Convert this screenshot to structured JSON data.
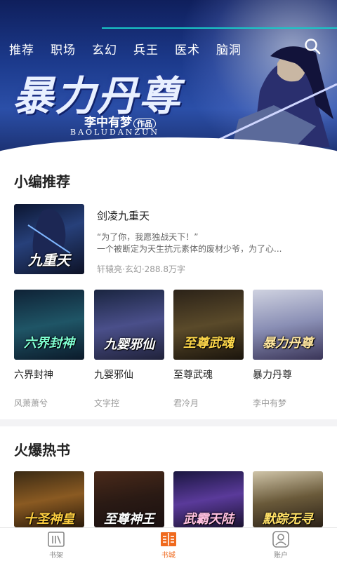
{
  "banner": {
    "tabs": [
      "推荐",
      "职场",
      "玄幻",
      "兵王",
      "医术",
      "脑洞"
    ],
    "title": "暴力丹尊",
    "author": "李中有梦",
    "author_tag": "作品",
    "pinyin": "BAOLUDANZUN",
    "slide_count": 3,
    "active_slide": 0
  },
  "recommend": {
    "title": "小编推荐",
    "featured": {
      "name": "剑凌九重天",
      "desc_line1": "“为了你，我愿独战天下！”",
      "desc_line2": "一个被断定为天生抗元素体的废材少爷，为了心...",
      "meta": "轩辕亮·玄幻·288.8万字",
      "cover_text": "九重天"
    },
    "books": [
      {
        "name": "六界封神",
        "author": "风萧萧兮",
        "cover_text": "六界封神"
      },
      {
        "name": "九婴邪仙",
        "author": "文字控",
        "cover_text": "九婴邪仙"
      },
      {
        "name": "至尊武魂",
        "author": "君冷月",
        "cover_text": "至尊武魂"
      },
      {
        "name": "暴力丹尊",
        "author": "李中有梦",
        "cover_text": "暴力丹尊"
      }
    ]
  },
  "hot": {
    "title": "火爆热书",
    "books": [
      {
        "cover_text": "十圣神皇"
      },
      {
        "cover_text": "至尊神王"
      },
      {
        "cover_text": "武霸天陆"
      },
      {
        "cover_text": "默踪无寻"
      }
    ]
  },
  "nav": {
    "items": [
      {
        "label": "书架",
        "icon": "bookshelf-icon"
      },
      {
        "label": "书城",
        "icon": "bookstore-icon"
      },
      {
        "label": "账户",
        "icon": "account-icon"
      }
    ],
    "active_color": "#f06a1e",
    "inactive_color": "#888888"
  },
  "colors": {
    "accent": "#f06a1e",
    "banner_line": "#19c6c6"
  }
}
